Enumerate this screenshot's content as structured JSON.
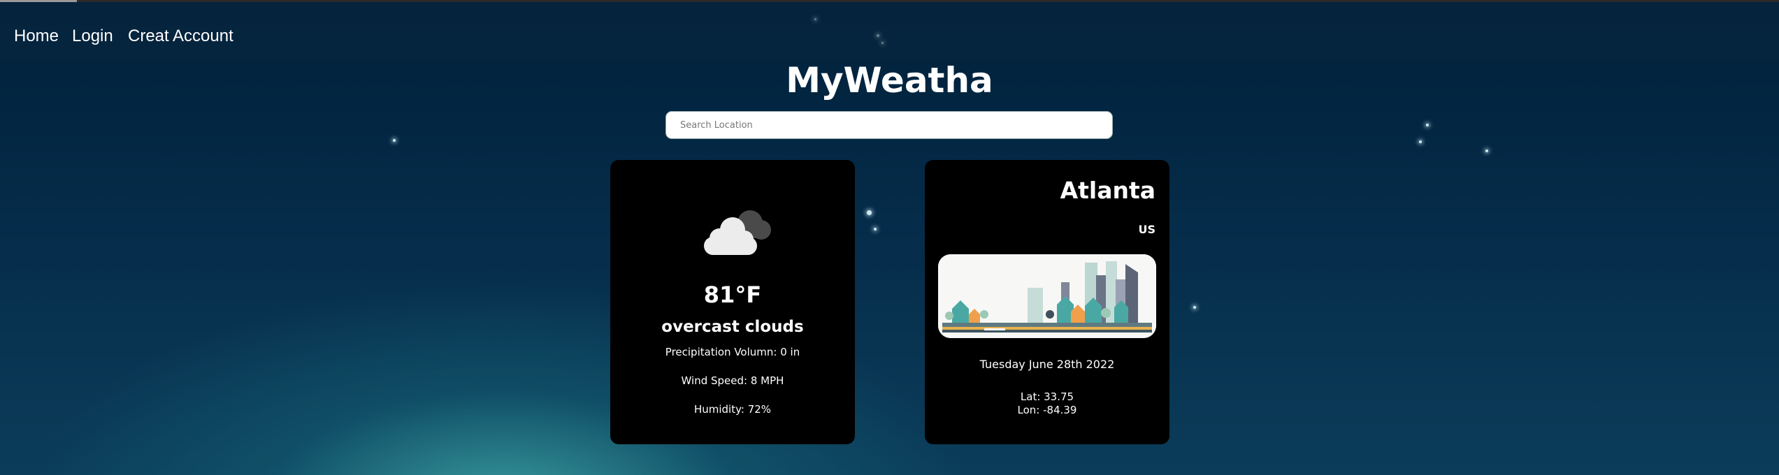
{
  "nav": {
    "items": [
      {
        "label": "Home"
      },
      {
        "label": "Login"
      },
      {
        "label": "Creat Account"
      }
    ]
  },
  "title": "MyWeatha",
  "search": {
    "placeholder": "Search Location",
    "value": ""
  },
  "weather": {
    "icon": "overcast-cloud-icon",
    "temperature": "81°F",
    "description": "overcast clouds",
    "precipitation": "Precipitation Volumn: 0 in",
    "wind": "Wind Speed: 8 MPH",
    "humidity": "Humidity: 72%"
  },
  "location": {
    "city": "Atlanta",
    "country": "US",
    "image": "city-skyline-illustration",
    "date": "Tuesday June 28th 2022",
    "lat": "Lat: 33.75",
    "lon": "Lon: -84.39"
  },
  "colors": {
    "background_top": "#00203a",
    "background_glow": "#40aaaa",
    "card": "#000000",
    "text": "#ffffff"
  }
}
